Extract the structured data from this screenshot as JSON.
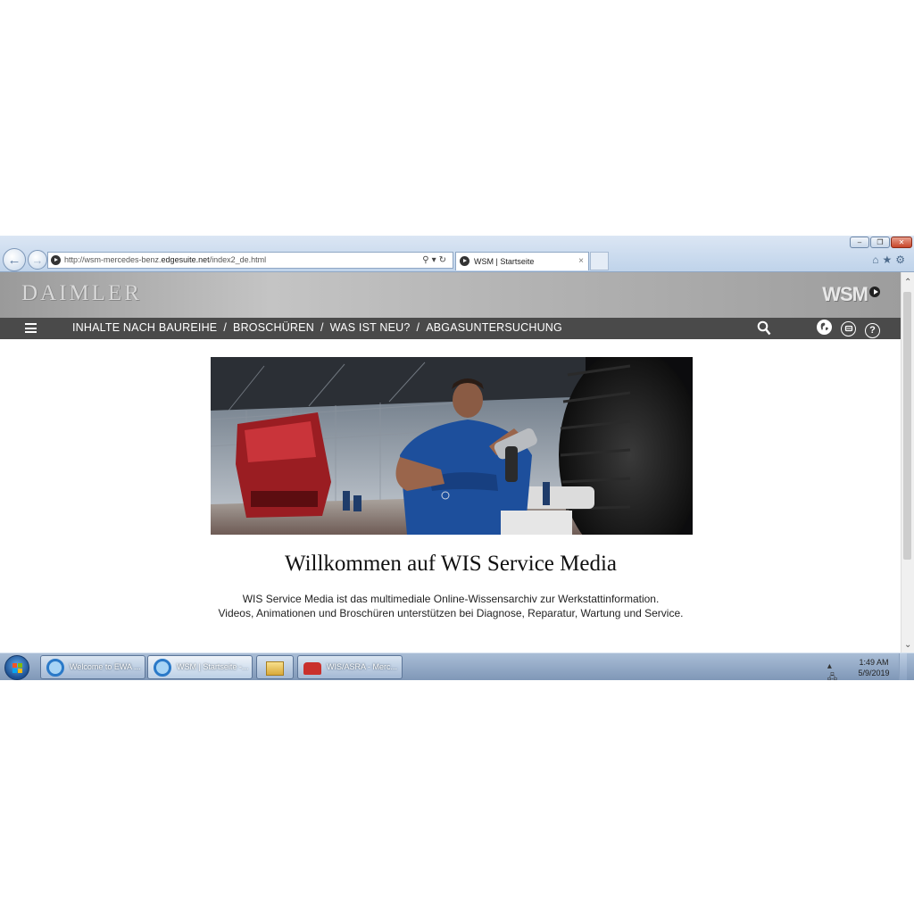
{
  "browser": {
    "url_prefix": "http://wsm-mercedes-benz.",
    "url_domain": "edgesuite.net",
    "url_path": "/index2_de.html",
    "tab_title": "WSM | Startseite",
    "tab_close": "×"
  },
  "site": {
    "logo": "DAIMLER",
    "product_logo": "WSM",
    "nav": {
      "items": [
        "INHALTE NACH BAUREIHE",
        "BROSCHÜREN",
        "WAS IST NEU?",
        "ABGASUNTERSUCHUNG"
      ],
      "separator": "/"
    },
    "welcome_title": "Willkommen auf WIS Service Media",
    "welcome_text_line1": "WIS Service Media ist das multimediale Online-Wissensarchiv zur Werkstattinformation.",
    "welcome_text_line2": "Videos, Animationen und Broschüren unterstützen bei Diagnose, Reparatur, Wartung und Service."
  },
  "taskbar": {
    "buttons": [
      {
        "label": "Welcome to EWA ...",
        "icon": "ie-icon"
      },
      {
        "label": "WSM | Startseite -...",
        "icon": "ie-icon"
      },
      {
        "label": "",
        "icon": "folder-icon"
      },
      {
        "label": "WIS/ASRA - Merc...",
        "icon": "car-icon"
      }
    ],
    "clock_time": "1:49 AM",
    "clock_date": "5/9/2019"
  }
}
